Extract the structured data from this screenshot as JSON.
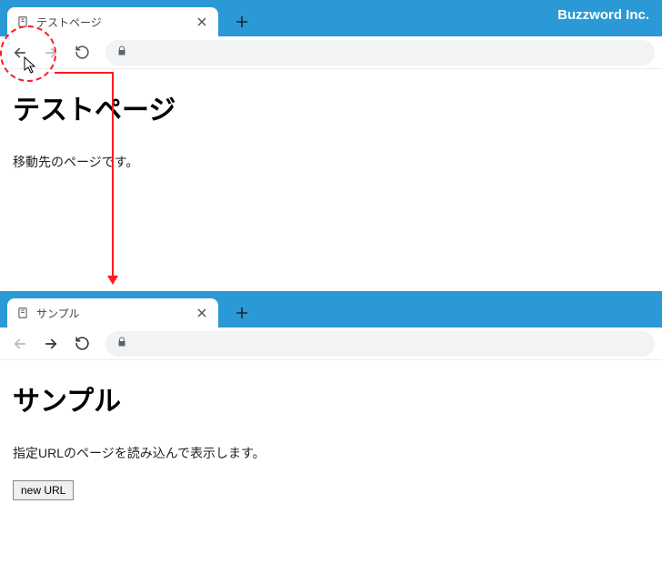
{
  "brand": "Buzzword Inc.",
  "browser1": {
    "tab": {
      "title": "テストページ"
    },
    "nav": {
      "back_enabled": true,
      "forward_enabled": false
    },
    "page": {
      "heading": "テストページ",
      "paragraph": "移動先のページです。"
    }
  },
  "browser2": {
    "tab": {
      "title": "サンプル"
    },
    "nav": {
      "back_enabled": false,
      "forward_enabled": true
    },
    "page": {
      "heading": "サンプル",
      "paragraph": "指定URLのページを読み込んで表示します。",
      "button_label": "new URL"
    }
  }
}
